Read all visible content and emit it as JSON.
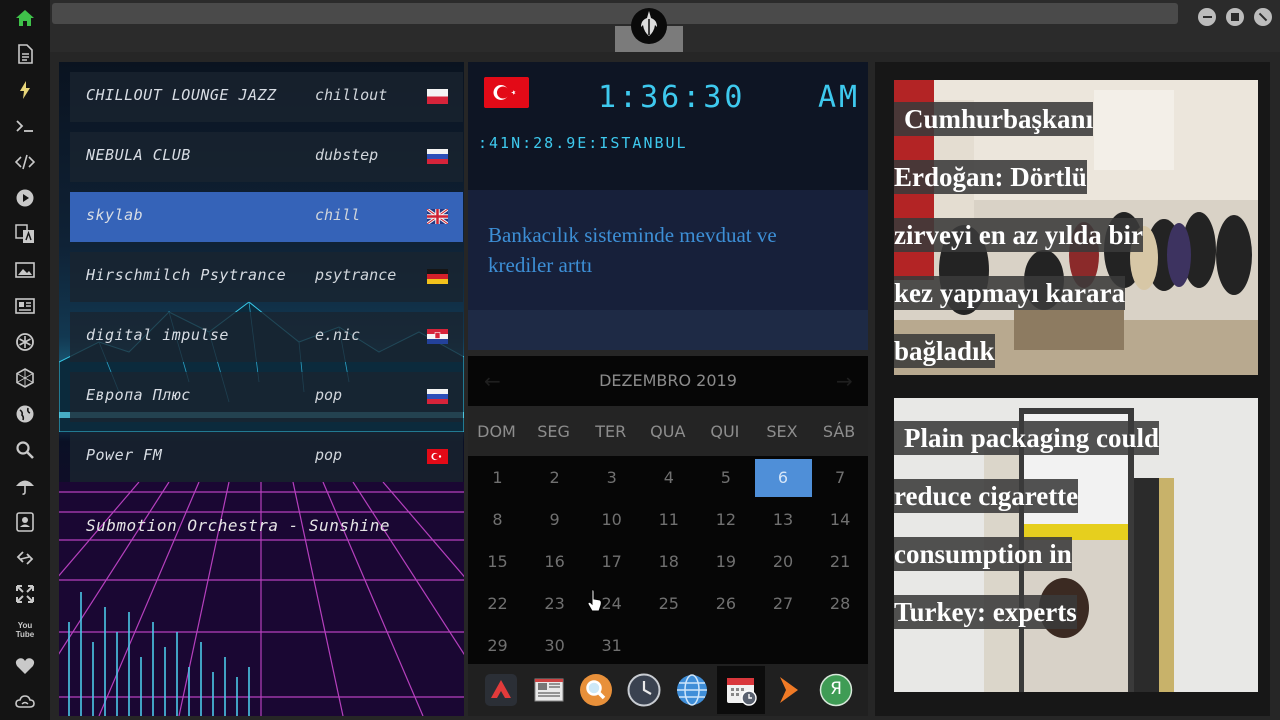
{
  "sidebar": {
    "items": [
      {
        "icon": "home-icon"
      },
      {
        "icon": "document-icon"
      },
      {
        "icon": "lightning-icon"
      },
      {
        "icon": "terminal-icon"
      },
      {
        "icon": "code-icon"
      },
      {
        "icon": "play-icon"
      },
      {
        "icon": "translate-icon"
      },
      {
        "icon": "image-icon"
      },
      {
        "icon": "news-icon"
      },
      {
        "icon": "rebel-icon"
      },
      {
        "icon": "hexagon-icon"
      },
      {
        "icon": "globe-icon"
      },
      {
        "icon": "search-icon"
      },
      {
        "icon": "umbrella-icon"
      },
      {
        "icon": "contact-icon"
      },
      {
        "icon": "link-icon"
      },
      {
        "icon": "expand-icon"
      },
      {
        "icon": "youtube-icon"
      },
      {
        "icon": "heart-icon"
      },
      {
        "icon": "cloud-icon"
      }
    ],
    "youtube_label": "You Tube",
    "accent_color": "#3fc24a"
  },
  "window": {
    "logo": "rebel-alliance-logo",
    "buttons": [
      "minimize",
      "maximize",
      "close"
    ]
  },
  "radio": {
    "stations": [
      {
        "name": "CHILLOUT LOUNGE JAZZ",
        "genre": "chillout",
        "flag": "pl"
      },
      {
        "name": "NEBULA CLUB",
        "genre": "dubstep",
        "flag": "ru"
      },
      {
        "name": "skylab",
        "genre": "chill",
        "flag": "gb",
        "active": true
      },
      {
        "name": "Hirschmilch Psytrance",
        "genre": "psytrance",
        "flag": "de"
      },
      {
        "name": "digital impulse",
        "genre": "e.nic",
        "flag": "hr"
      },
      {
        "name": "Европа Плюс",
        "genre": "pop",
        "flag": "ru"
      },
      {
        "name": "Power FM",
        "genre": "pop",
        "flag": "tr"
      }
    ],
    "now_playing": "Submotion Orchestra - Sunshine"
  },
  "clock": {
    "time": "1:36:30",
    "ampm": "AM",
    "location": ":41N:28.9E:ISTANBUL",
    "flag": "tr"
  },
  "ticker": {
    "headline": "Bankacılık sisteminde mevduat ve krediler arttı"
  },
  "calendar": {
    "month_label": "DEZEMBRO 2019",
    "weekdays": [
      "DOM",
      "SEG",
      "TER",
      "QUA",
      "QUI",
      "SEX",
      "SÁB"
    ],
    "days": [
      "1",
      "2",
      "3",
      "4",
      "5",
      "6",
      "7",
      "8",
      "9",
      "10",
      "11",
      "12",
      "13",
      "14",
      "15",
      "16",
      "17",
      "18",
      "19",
      "20",
      "21",
      "22",
      "23",
      "24",
      "25",
      "26",
      "27",
      "28",
      "29",
      "30",
      "31"
    ],
    "first_weekday_index": 0,
    "today": "6"
  },
  "dock": {
    "items": [
      {
        "icon": "arrow-up-app-icon"
      },
      {
        "icon": "newspaper-app-icon"
      },
      {
        "icon": "search-app-icon"
      },
      {
        "icon": "clock-app-icon"
      },
      {
        "icon": "globe-app-icon"
      },
      {
        "icon": "calendar-app-icon",
        "selected": true
      },
      {
        "icon": "play-arrow-app-icon"
      },
      {
        "icon": "yandex-app-icon"
      }
    ],
    "yandex_letter": "Я"
  },
  "news": [
    {
      "headline_lines": [
        "Cumhurbaşkanı",
        "Erdoğan: Dörtlü",
        "zirveyi en az yılda bir",
        "kez yapmayı karara",
        "bağladık"
      ]
    },
    {
      "headline_lines": [
        "Plain packaging could",
        "reduce cigarette",
        "consumption in",
        "Turkey: experts"
      ]
    }
  ]
}
